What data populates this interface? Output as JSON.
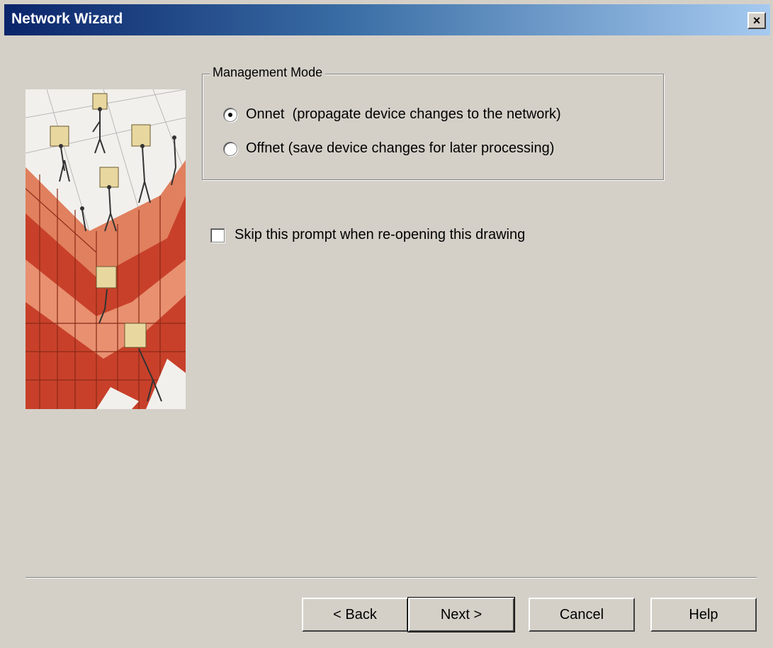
{
  "window": {
    "title": "Network Wizard",
    "close_glyph": "×"
  },
  "management_mode": {
    "legend": "Management Mode",
    "options": [
      {
        "label": "Onnet  (propagate device changes to the network)",
        "checked": true
      },
      {
        "label": "Offnet (save device changes for later processing)",
        "checked": false
      }
    ]
  },
  "skip_prompt": {
    "label": "Skip this prompt when re-opening this drawing",
    "checked": false
  },
  "buttons": {
    "back": "< Back",
    "next": "Next >",
    "cancel": "Cancel",
    "help": "Help"
  },
  "colors": {
    "dialog_bg": "#d4d0c8",
    "titlebar_start": "#0a246a",
    "titlebar_end": "#a6caf0",
    "tile_red": "#c8402a",
    "tile_light": "#e8a080"
  }
}
